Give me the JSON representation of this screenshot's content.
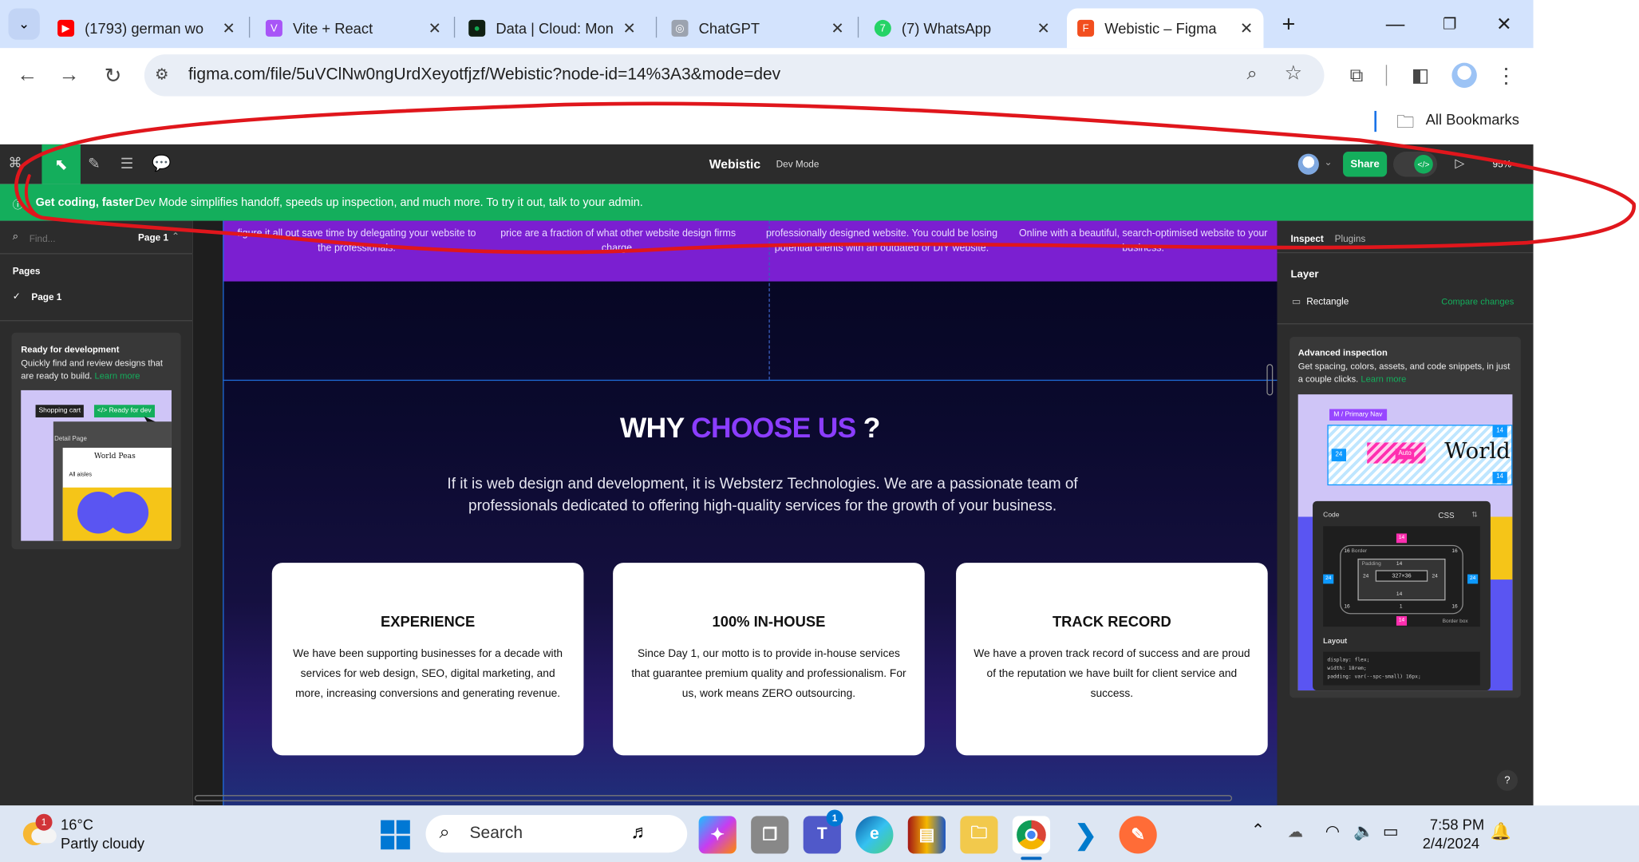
{
  "browser": {
    "tabs": [
      {
        "title": "(1793) german wo",
        "color": "#ff0000",
        "glyph": "▶"
      },
      {
        "title": "Vite + React",
        "color": "#a855f7",
        "glyph": "V"
      },
      {
        "title": "Data | Cloud: Mon",
        "color": "#0f1f12",
        "glyph": "●"
      },
      {
        "title": "ChatGPT",
        "color": "#6b7280",
        "glyph": "◎"
      },
      {
        "title": "(7) WhatsApp",
        "color": "#25d366",
        "glyph": "7"
      },
      {
        "title": "Webistic – Figma",
        "color": "#f24e1e",
        "glyph": "F"
      }
    ],
    "new_tab": "+",
    "url": "figma.com/file/5uVClNw0ngUrdXeyotfjzf/Webistic?node-id=14%3A3&mode=dev",
    "bookmarks_label": "All Bookmarks"
  },
  "figma": {
    "file_name": "Webistic",
    "mode_label": "Dev Mode",
    "share_label": "Share",
    "dev_toggle": "</>",
    "zoom": "95%",
    "banner_title": "Get coding, faster",
    "banner_text": "Dev Mode simplifies handoff, speeds up inspection, and much more. To try it out, talk to your admin.",
    "left": {
      "search_placeholder": "Find...",
      "page_selector": "Page 1",
      "pages_heading": "Pages",
      "pages": [
        "Page 1"
      ],
      "promo_title": "Ready for development",
      "promo_text": "Quickly find and review designs that are ready to build.",
      "promo_link": "Learn more",
      "thumb_tag1": "Shopping cart",
      "thumb_tag2": "</> Ready for dev",
      "thumb_detail": "Detail Page",
      "thumb_brand": "World Peas",
      "thumb_aisles": "All aisles"
    },
    "right": {
      "tabs": [
        "Inspect",
        "Plugins"
      ],
      "layer_heading": "Layer",
      "layer_name": "Rectangle",
      "compare_link": "Compare changes",
      "adv_title": "Advanced inspection",
      "adv_text": "Get spacing, colors, assets, and code snippets, in just a couple clicks.",
      "adv_link": "Learn more",
      "preview_nav": "M / Primary Nav",
      "preview_word": "World",
      "preview_auto": "Auto",
      "code_label": "Code",
      "css_label": "CSS",
      "box_border": "Border",
      "box_padding": "Padding",
      "box_size": "327×36",
      "box_border_box": "Border box",
      "layout_label": "Layout",
      "code_lines": [
        "display: flex;",
        "width: 18rem;",
        "padding: var(--spc-small) 16px;"
      ],
      "box_values": {
        "outer": "16",
        "pad": "14",
        "side": "24",
        "one": "1"
      },
      "help": "?"
    },
    "design": {
      "band_texts": [
        "figure it all out save time by delegating your website to the professionals.",
        "price are a fraction of what other website design firms charge.",
        "professionally designed website. You could be losing potential clients with an outdated or DIY website.",
        "Online with a beautiful, search-optimised website to your business."
      ],
      "heading_white": "WHY",
      "heading_purple": "CHOOSE US",
      "heading_mark": "?",
      "intro": "If it is web design and development, it is Websterz Technologies. We are a passionate team of professionals dedicated to offering high-quality services for the growth of your business.",
      "cards": [
        {
          "title": "EXPERIENCE",
          "text": "We have been supporting businesses for a decade with services for web design, SEO, digital marketing, and more, increasing conversions and generating revenue."
        },
        {
          "title": "100% IN-HOUSE",
          "text": "Since Day 1, our motto is to provide in-house services that guarantee premium quality and professionalism. For us, work means ZERO outsourcing."
        },
        {
          "title": "TRACK RECORD",
          "text": "We have a proven track record of success and are proud of the reputation we have built for client service and success."
        }
      ]
    }
  },
  "taskbar": {
    "weather_temp": "16°C",
    "weather_desc": "Partly cloudy",
    "weather_badge": "1",
    "search_label": "Search",
    "time": "7:58 PM",
    "date": "2/4/2024",
    "teams_badge": "1"
  },
  "colors": {
    "figma_green": "#14ae5c",
    "purple": "#7b1fd1",
    "accent_purple": "#8b3dff",
    "annotation_red": "#e0161c"
  }
}
